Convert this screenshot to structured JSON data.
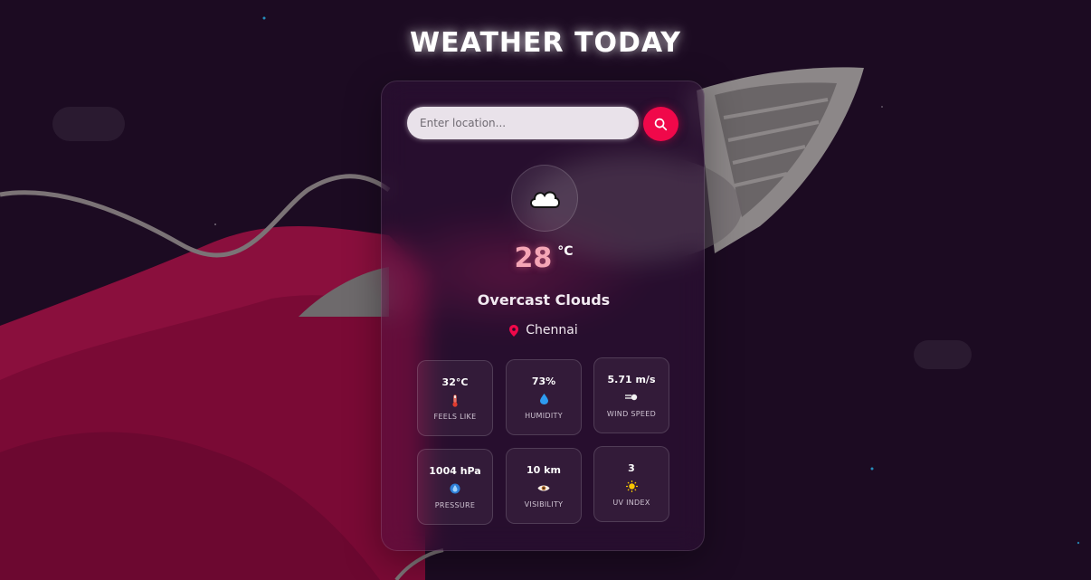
{
  "header": {
    "title": "WEATHER TODAY"
  },
  "search": {
    "placeholder": "Enter location..."
  },
  "current": {
    "temperature": "28",
    "unit": "°C",
    "condition": "Overcast Clouds",
    "location": "Chennai",
    "icon": "cloud-icon"
  },
  "stats": [
    {
      "value": "32°C",
      "label": "FEELS LIKE",
      "icon": "thermometer-icon"
    },
    {
      "value": "73%",
      "label": "HUMIDITY",
      "icon": "droplet-icon"
    },
    {
      "value": "5.71 m/s",
      "label": "WIND SPEED",
      "icon": "wind-icon"
    },
    {
      "value": "1004 hPa",
      "label": "PRESSURE",
      "icon": "pressure-icon"
    },
    {
      "value": "10 km",
      "label": "VISIBILITY",
      "icon": "eye-icon"
    },
    {
      "value": "3",
      "label": "UV INDEX",
      "icon": "sun-icon"
    }
  ],
  "colors": {
    "accent": "#f0084a",
    "background": "#1a0a1f",
    "temperature": "#f5a6b6"
  }
}
